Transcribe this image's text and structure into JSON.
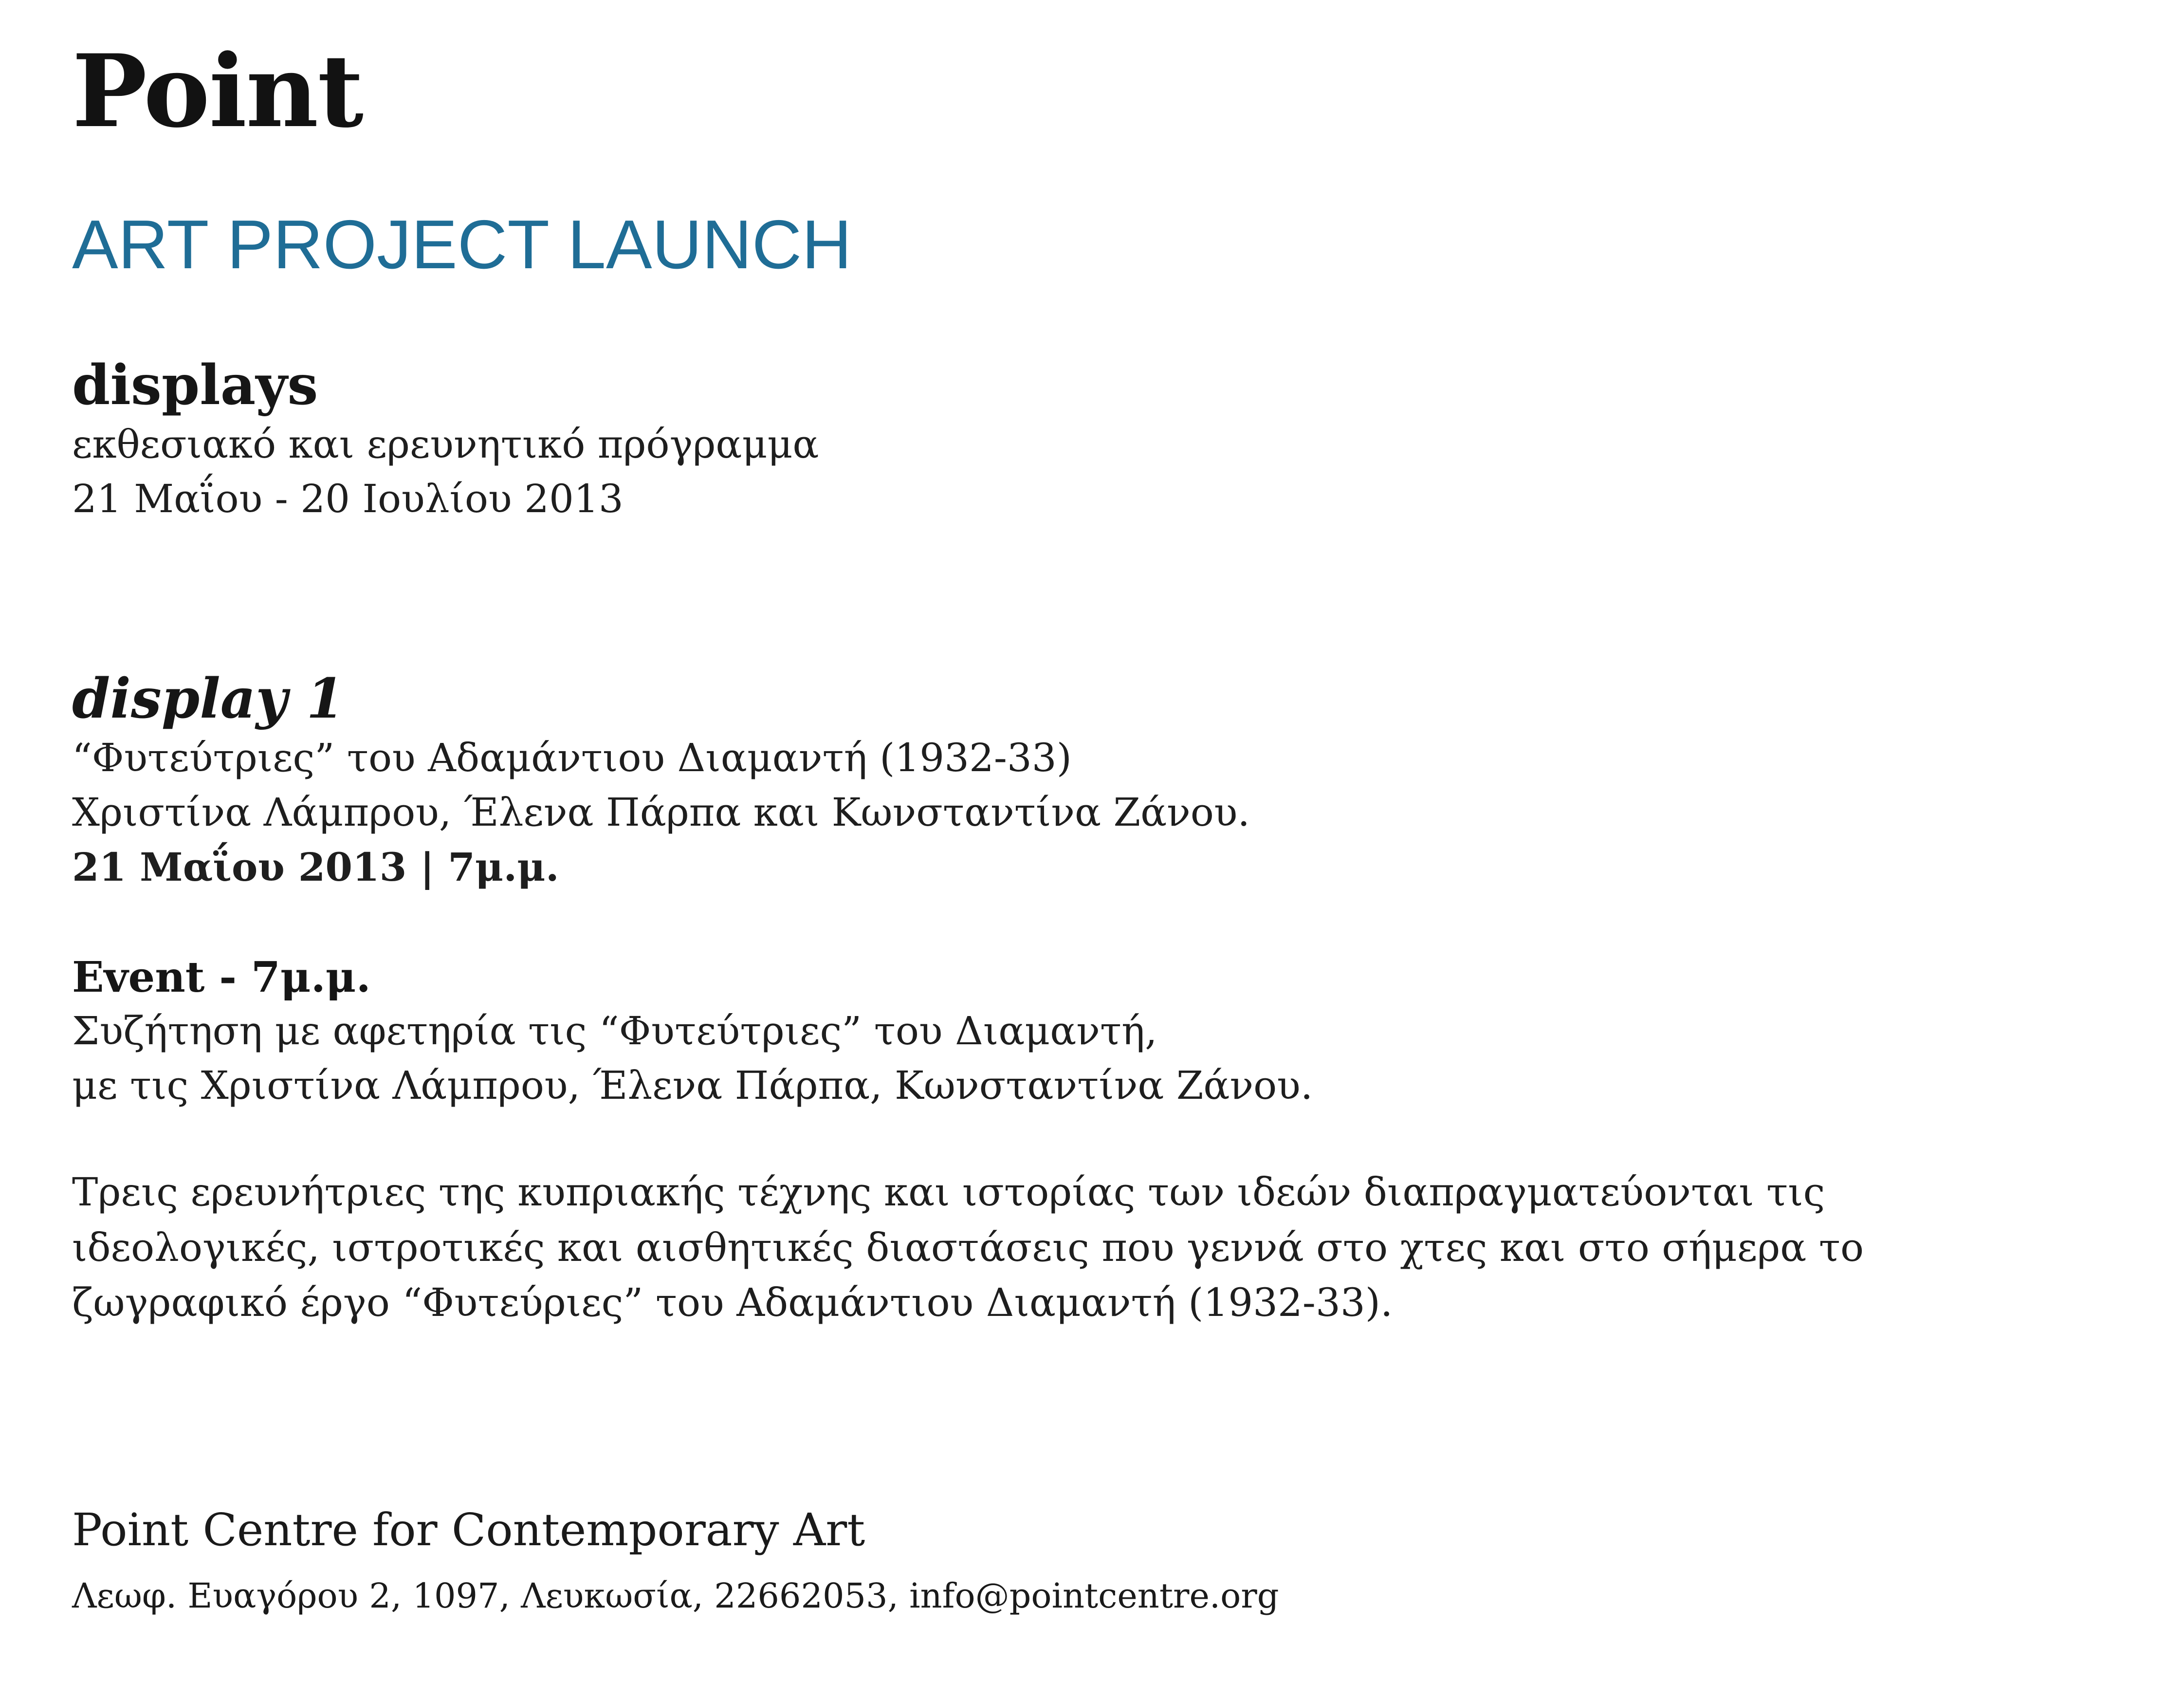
{
  "logo": "Point",
  "headline": "ART PROJECT LAUNCH",
  "displays": {
    "title": "displays",
    "subtitle": "εκθεσιακό και ερευνητικό πρόγραμμα",
    "dates": "21 Μαΐου - 20 Ιουλίου 2013"
  },
  "display1": {
    "title": "display 1",
    "work": "“Φυτεύτριες” του Αδαμάντιου Διαμαντή (1932-33)",
    "researchers": "Χριστίνα Λάμπρου, Έλενα Πάρπα και Κωνσταντίνα Ζάνου.",
    "datetime": "21 Μαΐου 2013 | 7μ.μ."
  },
  "event": {
    "title": "Event - 7μ.μ.",
    "line1": "Συζήτηση με αφετηρία τις “Φυτεύτριες” του Διαμαντή,",
    "line2": "με τις Χριστίνα Λάμπρου, Έλενα Πάρπα, Κωνσταντίνα Ζάνου."
  },
  "description": {
    "line1": "Τρεις ερευνήτριες της κυπριακής τέχνης και ιστορίας των ιδεών διαπραγματεύονται τις",
    "line2": "ιδεολογικές, ιστροτικές και αισθητικές διαστάσεις που γεννά στο χτες και στο σήμερα το",
    "line3": "ζωγραφικό έργο “Φυτεύριες” του Αδαμάντιου Διαμαντή (1932-33)."
  },
  "footer": {
    "name": "Point Centre for Contemporary Art",
    "address": "Λεωφ. Ευαγόρου 2, 1097, Λευκωσία, 22662053, info@pointcentre.org"
  },
  "colors": {
    "headline": "#1f6d96",
    "text": "#1c1c1c",
    "background": "#ffffff"
  }
}
